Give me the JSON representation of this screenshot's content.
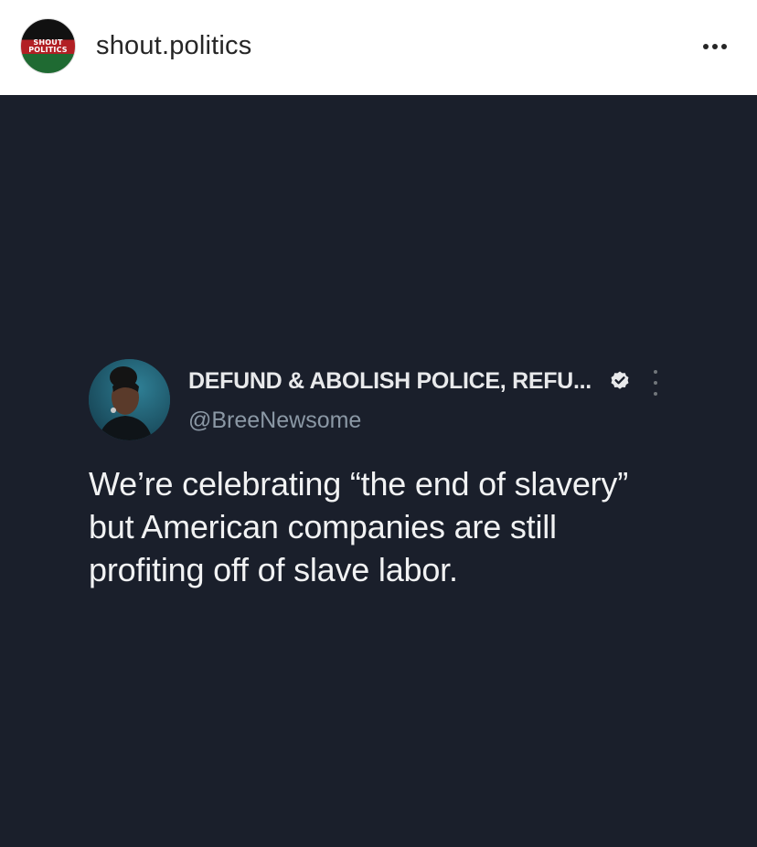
{
  "header": {
    "avatar_logo_line1": "SHOUT",
    "avatar_logo_line2": "POLITICS",
    "username": "shout.politics",
    "more_icon": "more-horizontal-icon"
  },
  "tweet": {
    "display_name": "DEFUND & ABOLISH POLICE, REFU...",
    "verified_icon": "verified-badge-icon",
    "handle": "@BreeNewsome",
    "more_icon": "more-vertical-icon",
    "text_lines": [
      "We’re celebrating “the end of slavery”",
      "but American companies are still",
      "profiting off of slave labor."
    ]
  },
  "colors": {
    "post_background": "#1a1f2b",
    "header_background": "#ffffff",
    "username_text": "#262626",
    "tweet_text": "#f1f2f3",
    "handle_text": "#8b98a5"
  }
}
